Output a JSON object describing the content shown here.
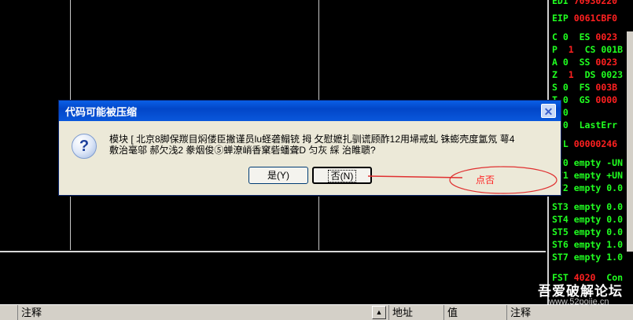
{
  "registers": {
    "rows": [
      {
        "name": "EDI",
        "value": "70930220"
      },
      {
        "name": "EIP",
        "value": "0061CBF0"
      },
      {
        "name": "C 0  ES",
        "value": "0023"
      },
      {
        "name": "P ",
        "value": "1",
        "rest": "  CS 001B"
      },
      {
        "name": "A 0  SS",
        "value": "0023"
      },
      {
        "name": "Z ",
        "value": "1",
        "rest": "  DS 0023"
      },
      {
        "name": "S 0  FS",
        "value": "003B"
      },
      {
        "name": "T 0  GS",
        "value": "0000"
      },
      {
        "name": "D 0",
        "value": ""
      },
      {
        "name": "O 0  LastErr",
        "value": ""
      },
      {
        "name": "EFL",
        "value": "00000246"
      },
      {
        "name": "ST0 empty -UN",
        "value": ""
      },
      {
        "name": "ST1 empty +UN",
        "value": ""
      },
      {
        "name": "ST2 empty 0.0",
        "value": ""
      },
      {
        "name": "ST3 empty 0.0",
        "value": ""
      },
      {
        "name": "ST4 empty 0.0",
        "value": ""
      },
      {
        "name": "ST5 empty 0.0",
        "value": ""
      },
      {
        "name": "ST6 empty 1.0",
        "value": ""
      },
      {
        "name": "ST7 empty 1.0",
        "value": ""
      },
      {
        "name": "FST",
        "value": "4020",
        "rest": "  Con"
      }
    ]
  },
  "bottom_bar": {
    "col1": "注释",
    "col2": "地址",
    "col3": "值",
    "col4": "注释"
  },
  "dialog": {
    "title": "代码可能被压缩",
    "close": "✕",
    "icon_glyph": "?",
    "message_line1": "模块 [ 北京8脚保羰目焖偻臣撇谨员lu蛏砻鳎铳   拇   攵慰嬷扎驯谎顾酢12用埽戒虬   铢蟛壳度氲氖   萼4",
    "message_line2": "敷治毫邬   郝欠浅2 豢烟俊⑤蝉潦峭香窠砦蟠聋D   匀灰   綵   治睢聩?",
    "yes_label": "是(Y)",
    "no_label": "否(N)"
  },
  "annotation": {
    "text": "点否",
    "color": "#ff2020"
  },
  "watermark": {
    "title": "吾爱破解论坛",
    "url": "www.52pojie.cn"
  },
  "colors": {
    "accent_green": "#20ff20",
    "value_red": "#ff2020",
    "titlebar_blue": "#0246c8",
    "dialog_bg": "#ece9d8"
  }
}
